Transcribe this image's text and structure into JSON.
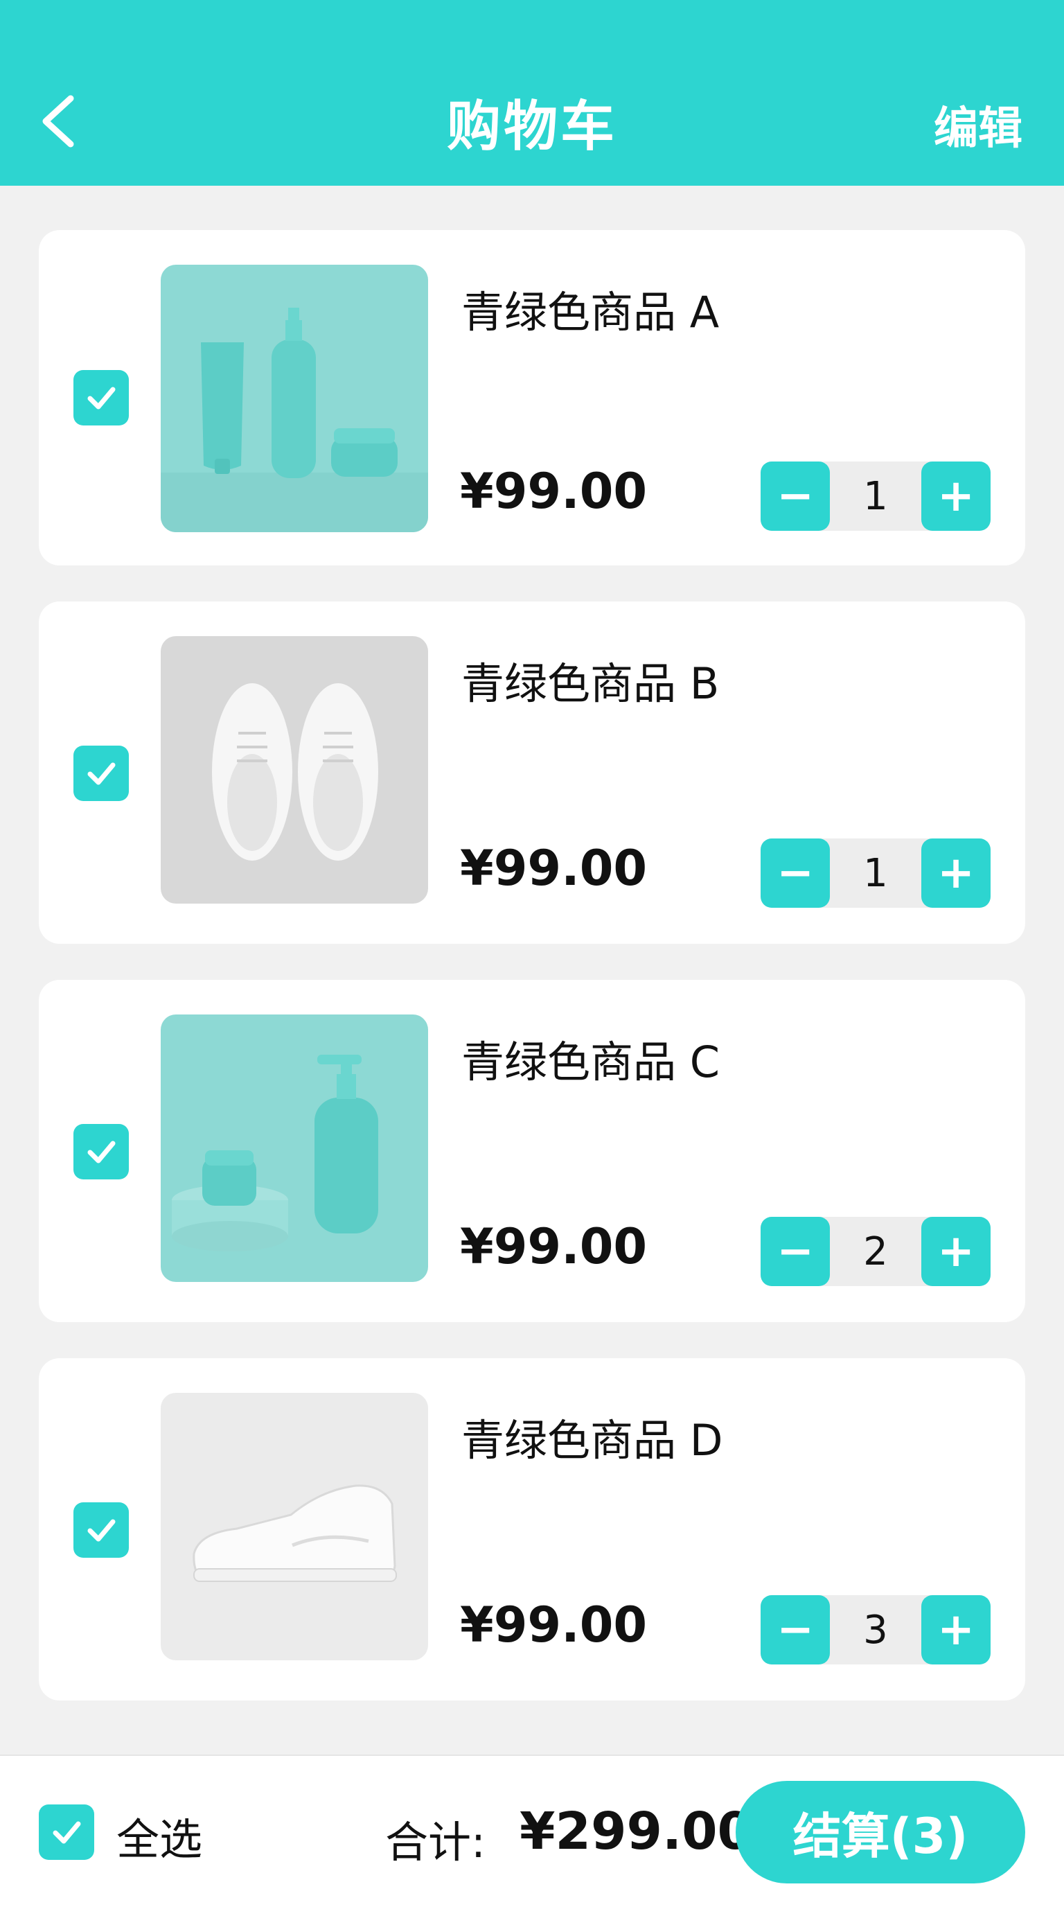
{
  "header": {
    "title": "购物车",
    "edit_label": "编辑",
    "back_icon": "chevron-left-icon"
  },
  "colors": {
    "accent": "#2dd5d0",
    "background": "#f1f1f1",
    "card": "#ffffff"
  },
  "items": [
    {
      "name": "青绿色商品 A",
      "price": "¥99.00",
      "qty": "1",
      "checked": true,
      "image": "teal cosmetics set (tube, spray bottle, jar)"
    },
    {
      "name": "青绿色商品 B",
      "price": "¥99.00",
      "qty": "1",
      "checked": true,
      "image": "pair of white sneakers top view"
    },
    {
      "name": "青绿色商品 C",
      "price": "¥99.00",
      "qty": "2",
      "checked": true,
      "image": "teal pump bottle and jar on pedestal"
    },
    {
      "name": "青绿色商品 D",
      "price": "¥99.00",
      "qty": "3",
      "checked": true,
      "image": "single white sneaker side view"
    }
  ],
  "stepper": {
    "minus": "−",
    "plus": "+"
  },
  "footer": {
    "select_all_label": "全选",
    "select_all_checked": true,
    "total_label": "合计:",
    "total_value": "¥299.00",
    "checkout_label": "结算(3)"
  }
}
